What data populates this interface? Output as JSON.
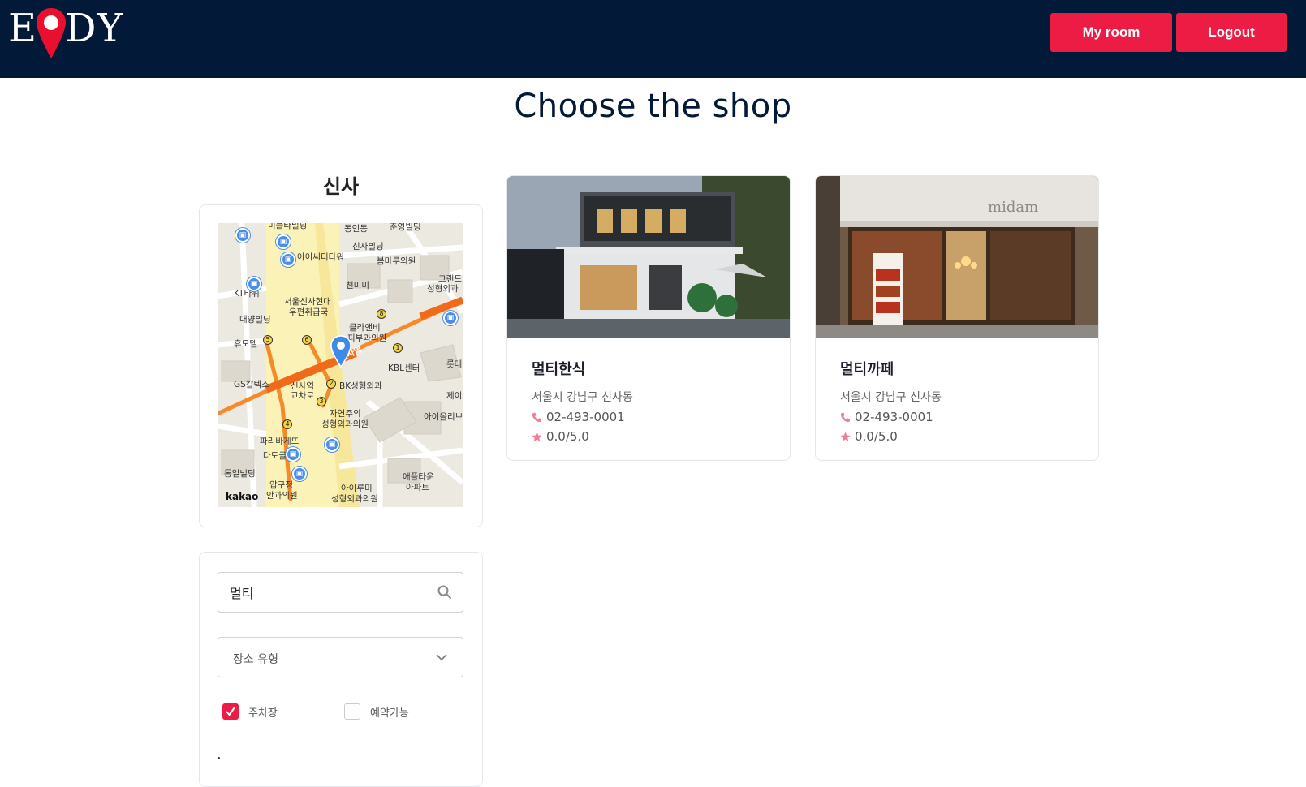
{
  "header": {
    "logo_left": "E",
    "logo_right": "DY",
    "my_room_label": "My room",
    "logout_label": "Logout"
  },
  "page": {
    "title": "Choose the shop"
  },
  "region": {
    "name": "신사"
  },
  "map": {
    "attribution": "kakao",
    "labels": [
      "미플타빌딩",
      "동인동",
      "준영빌딩",
      "신사빌딩",
      "봄마루의원",
      "아이씨티타워",
      "천미미",
      "그랜드",
      "성형외과",
      "KT타워",
      "서울신사현대",
      "우편취급국",
      "대양빌딩",
      "클라앤비",
      "피부과의원",
      "휴모텔",
      "KBL센터",
      "롯데",
      "GS칼텍스",
      "신사역",
      "교차로",
      "BK성형외과",
      "제이",
      "자연주의",
      "성형외과의원",
      "아이올리브",
      "파리바게뜨",
      "다도글",
      "통일빌딩",
      "압구정",
      "안과의원",
      "아이루미",
      "성형외과의원",
      "애플타운",
      "아파트",
      "신사역"
    ]
  },
  "filters": {
    "search_value": "멀티",
    "search_placeholder": "",
    "place_type_label": "장소 유형",
    "parking_label": "주차장",
    "parking_checked": true,
    "reservation_label": "예약가능",
    "reservation_checked": false
  },
  "shops": [
    {
      "name": "멀티한식",
      "address": "서울시 강남구 신사동",
      "phone": "02-493-0001",
      "rating": "0.0/5.0"
    },
    {
      "name": "멀티까페",
      "address": "서울시 강남구 신사동",
      "phone": "02-493-0001",
      "rating": "0.0/5.0",
      "sign_text": "midam"
    }
  ],
  "colors": {
    "header_bg": "#021a38",
    "accent": "#ec1c45",
    "icon_pink": "#f07e98"
  }
}
